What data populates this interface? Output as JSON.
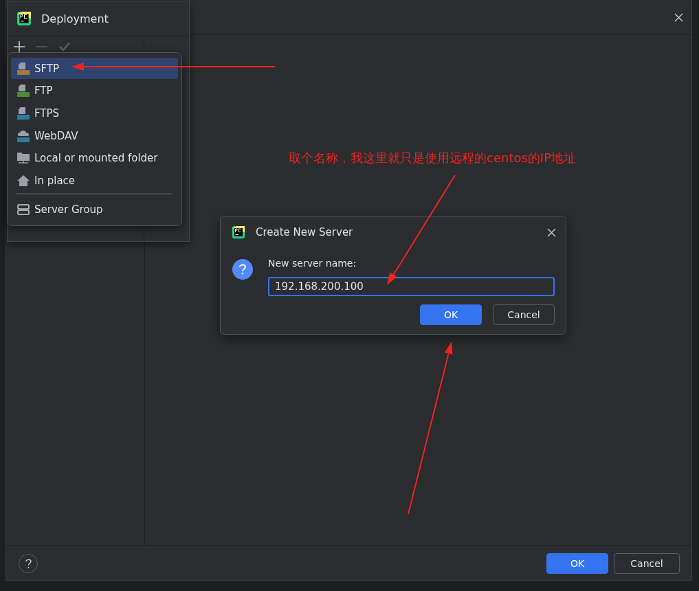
{
  "main_dialog": {
    "buttons": [
      {
        "label": "OK",
        "kind": "primary"
      },
      {
        "label": "Cancel",
        "kind": "secondary"
      }
    ]
  },
  "deployment": {
    "title": "Deployment",
    "toolbar": [
      {
        "kind": "add",
        "disabled": false
      },
      {
        "kind": "remove",
        "disabled": true
      },
      {
        "kind": "apply",
        "disabled": true
      }
    ]
  },
  "add_menu": {
    "items": [
      {
        "label": "SFTP",
        "kind": "sftp",
        "selected": true
      },
      {
        "label": "FTP",
        "kind": "ftp",
        "selected": false
      },
      {
        "label": "FTPS",
        "kind": "ftps",
        "selected": false
      },
      {
        "label": "WebDAV",
        "kind": "webdav",
        "selected": false
      },
      {
        "label": "Local or mounted folder",
        "kind": "folder",
        "selected": false
      },
      {
        "label": "In place",
        "kind": "home",
        "selected": false
      }
    ],
    "extra_items": [
      {
        "label": "Server Group",
        "kind": "group",
        "selected": false
      }
    ]
  },
  "create_dialog": {
    "title": "Create New Server",
    "prompt": "New server name:",
    "value": "192.168.200.100",
    "buttons": [
      {
        "label": "OK",
        "kind": "primary"
      },
      {
        "label": "Cancel",
        "kind": "secondary"
      }
    ]
  },
  "annotation": {
    "text": "取个名称，我这里就只是使用远程的centos的IP地址"
  }
}
